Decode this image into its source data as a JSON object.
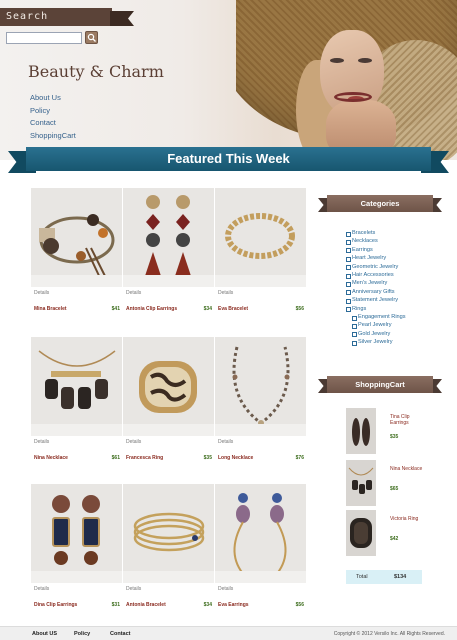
{
  "header": {
    "search_label": "Search",
    "search_placeholder": "",
    "brand": "Beauty & Charm",
    "nav": [
      "About Us",
      "Policy",
      "Contact",
      "ShoppingCart"
    ]
  },
  "featured": {
    "title": "Featured This Week"
  },
  "products": [
    {
      "name": "Mina Bracelet",
      "price": "$41",
      "details": "Details"
    },
    {
      "name": "Antonia Clip Earrings",
      "price": "$34",
      "details": "Details"
    },
    {
      "name": "Eva Bracelet",
      "price": "$56",
      "details": "Details"
    },
    {
      "name": "Nina Necklace",
      "price": "$61",
      "details": "Details"
    },
    {
      "name": "Francesca Ring",
      "price": "$35",
      "details": "Details"
    },
    {
      "name": "Long Necklace",
      "price": "$76",
      "details": "Details"
    },
    {
      "name": "Dina Clip Earrings",
      "price": "$31",
      "details": "Details"
    },
    {
      "name": "Antonia Bracelet",
      "price": "$34",
      "details": "Details"
    },
    {
      "name": "Eva Earrings",
      "price": "$56",
      "details": "Details"
    }
  ],
  "sidebar": {
    "categories_title": "Categories",
    "categories": [
      {
        "label": "Bracelets",
        "sub": false
      },
      {
        "label": "Necklaces",
        "sub": false
      },
      {
        "label": "Earrings",
        "sub": false
      },
      {
        "label": "Heart Jewelry",
        "sub": false
      },
      {
        "label": "Geometric Jewelry",
        "sub": false
      },
      {
        "label": "Hair Accessories",
        "sub": false
      },
      {
        "label": "Men's Jewelry",
        "sub": false
      },
      {
        "label": "Anniversary Gifts",
        "sub": false
      },
      {
        "label": "Statement Jewelry",
        "sub": false
      },
      {
        "label": "Rings",
        "sub": false
      },
      {
        "label": "Engagement Rings",
        "sub": true
      },
      {
        "label": "Pearl Jewelry",
        "sub": true
      },
      {
        "label": "Gold Jewelry",
        "sub": true
      },
      {
        "label": "Silver Jewelry",
        "sub": true
      }
    ],
    "cart_title": "ShoppingCart",
    "cart_items": [
      {
        "name": "Tina Clip Earrings",
        "price": "$35"
      },
      {
        "name": "Nina Necklace",
        "price": "$65"
      },
      {
        "name": "Victoria Ring",
        "price": "$42"
      }
    ],
    "total_label": "Total",
    "total_value": "$134"
  },
  "footer": {
    "links": [
      "About US",
      "Policy",
      "Contact"
    ],
    "copyright": "Copyright © 2012 Versilo Inc. All Rights Reserved."
  },
  "colors": {
    "ribbon": "#1f6582",
    "banner_brown": "#6e5448",
    "link_blue": "#2c6b98",
    "name_red": "#8a2a1f",
    "price_green": "#3d6d1d"
  }
}
